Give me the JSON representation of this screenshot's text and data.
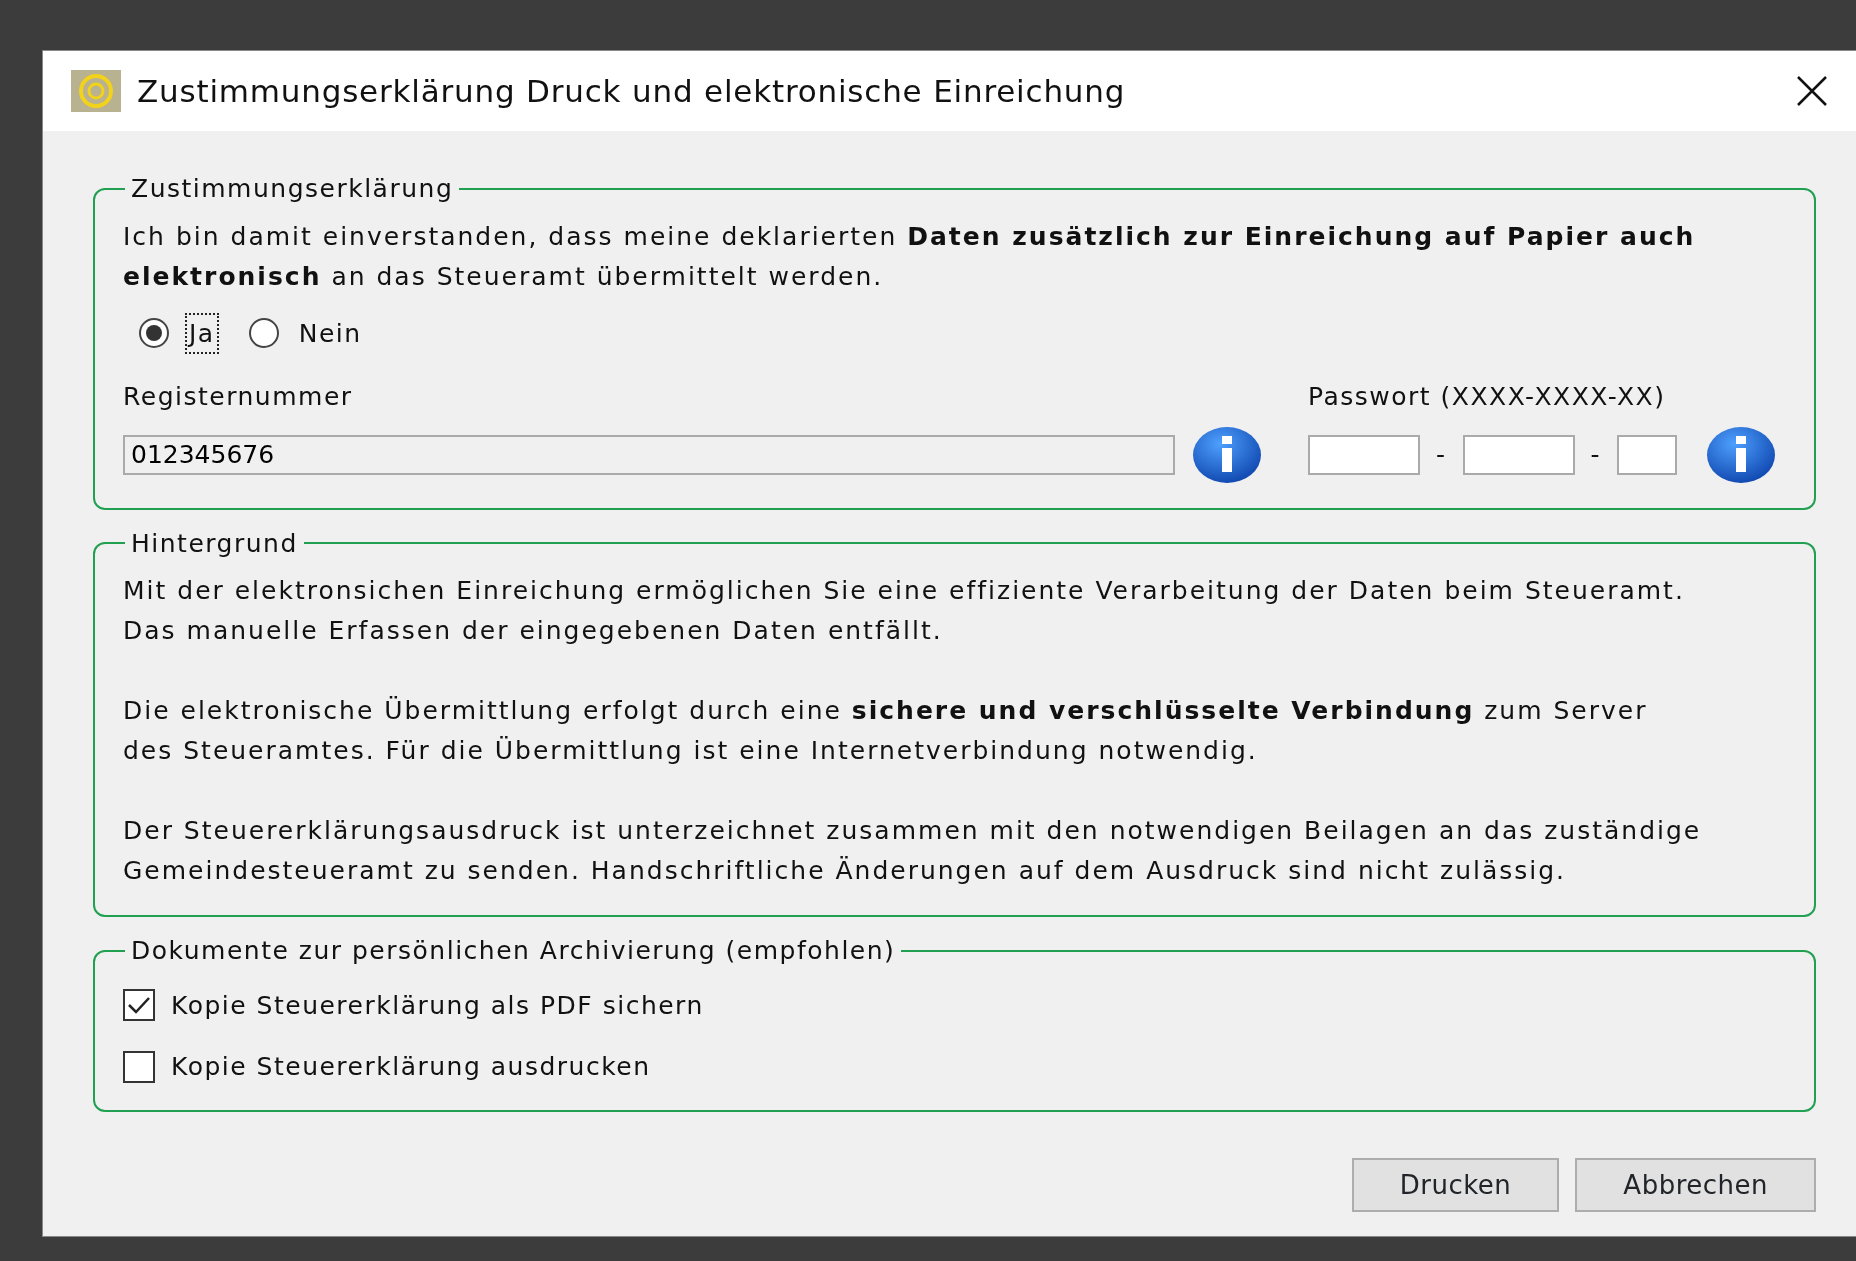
{
  "window": {
    "title": "Zustimmungserklärung Druck und elektronische Einreichung"
  },
  "consent": {
    "legend": "Zustimmungserklärung",
    "text_lines": [
      "Ich bin damit einverstanden, dass meine deklarierten **Daten zusätzlich zur Einreichung auf Papier auch**",
      "**elektronisch** an das Steueramt übermittelt werden."
    ],
    "options": [
      {
        "label": "Ja",
        "selected": true,
        "focused": true
      },
      {
        "label": "Nein",
        "selected": false,
        "focused": false
      }
    ],
    "register": {
      "label": "Registernummer",
      "value": "012345676"
    },
    "password": {
      "label": "Passwort (XXXX-XXXX-XX)",
      "separators": [
        "-",
        "-"
      ]
    }
  },
  "background": {
    "legend": "Hintergrund",
    "paragraphs": [
      [
        "Mit der elektronsichen Einreichung ermöglichen Sie eine effiziente Verarbeitung der Daten beim Steueramt.",
        "Das manuelle Erfassen der eingegebenen Daten entfällt."
      ],
      [
        "Die elektronische Übermittlung erfolgt durch eine **sichere und verschlüsselte Verbindung** zum Server",
        "des Steueramtes. Für die Übermittlung ist eine Internetverbindung notwendig."
      ],
      [
        "Der Steuererklärungsausdruck ist unterzeichnet zusammen mit den notwendigen Beilagen an das zuständige",
        "Gemeindesteueramt zu senden. Handschriftliche Änderungen auf dem Ausdruck sind nicht zulässig."
      ]
    ]
  },
  "documents": {
    "legend": "Dokumente zur persönlichen Archivierung (empfohlen)",
    "items": [
      {
        "label": "Kopie Steuererklärung als PDF sichern",
        "checked": true
      },
      {
        "label": "Kopie Steuererklärung ausdrucken",
        "checked": false
      }
    ]
  },
  "buttons": [
    "Drucken",
    "Abbrechen"
  ]
}
